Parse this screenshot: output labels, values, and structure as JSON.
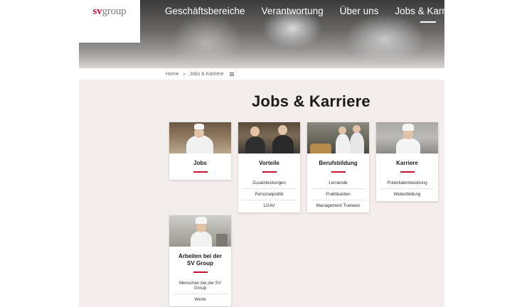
{
  "logo": {
    "brand_red": "sv",
    "brand_gray": "group",
    "colors": {
      "red": "#c8102e",
      "gray": "#7a7a7a"
    }
  },
  "nav": {
    "items": [
      {
        "label": "Geschäftsbereiche",
        "active": false
      },
      {
        "label": "Verantwortung",
        "active": false
      },
      {
        "label": "Über uns",
        "active": false
      },
      {
        "label": "Jobs & Karriere",
        "active": true
      }
    ]
  },
  "breadcrumb": {
    "home": "Home",
    "separator": ">",
    "current": "Jobs & Karriere",
    "menu_icon": "menu-icon"
  },
  "page": {
    "title": "Jobs & Karriere"
  },
  "accent_color": "#c8102e",
  "cards": [
    {
      "title": "Jobs",
      "links": []
    },
    {
      "title": "Vorteile",
      "links": [
        "Zusatzleistungen",
        "Personalpolitik",
        "LGAV"
      ]
    },
    {
      "title": "Berufsbildung",
      "links": [
        "Lernende",
        "Praktikanten",
        "Management Trainees"
      ]
    },
    {
      "title": "Karriere",
      "links": [
        "Potentialentwicklung",
        "Weiterbildung"
      ]
    },
    {
      "title": "Arbeiten bei der SV Group",
      "links": [
        "Menschen bei der SV Group",
        "Werte"
      ]
    }
  ]
}
